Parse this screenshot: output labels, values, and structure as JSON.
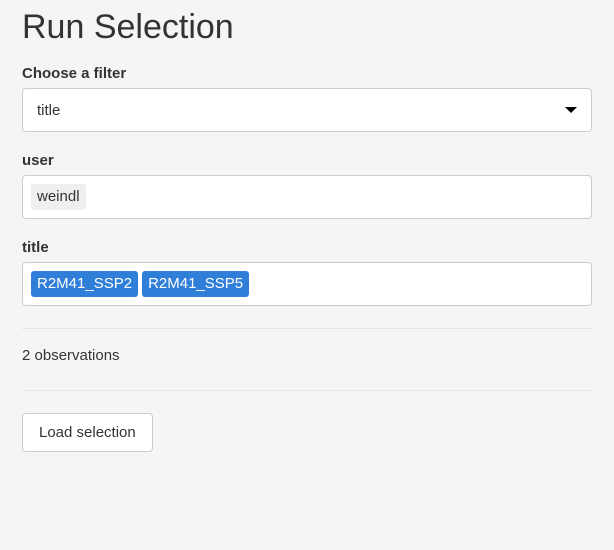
{
  "heading": "Run Selection",
  "filter": {
    "label": "Choose a filter",
    "selected": "title"
  },
  "user": {
    "label": "user",
    "tags": [
      "weindl"
    ]
  },
  "title_field": {
    "label": "title",
    "tags": [
      "R2M41_SSP2",
      "R2M41_SSP5"
    ]
  },
  "status": "2 observations",
  "load_button": "Load selection"
}
